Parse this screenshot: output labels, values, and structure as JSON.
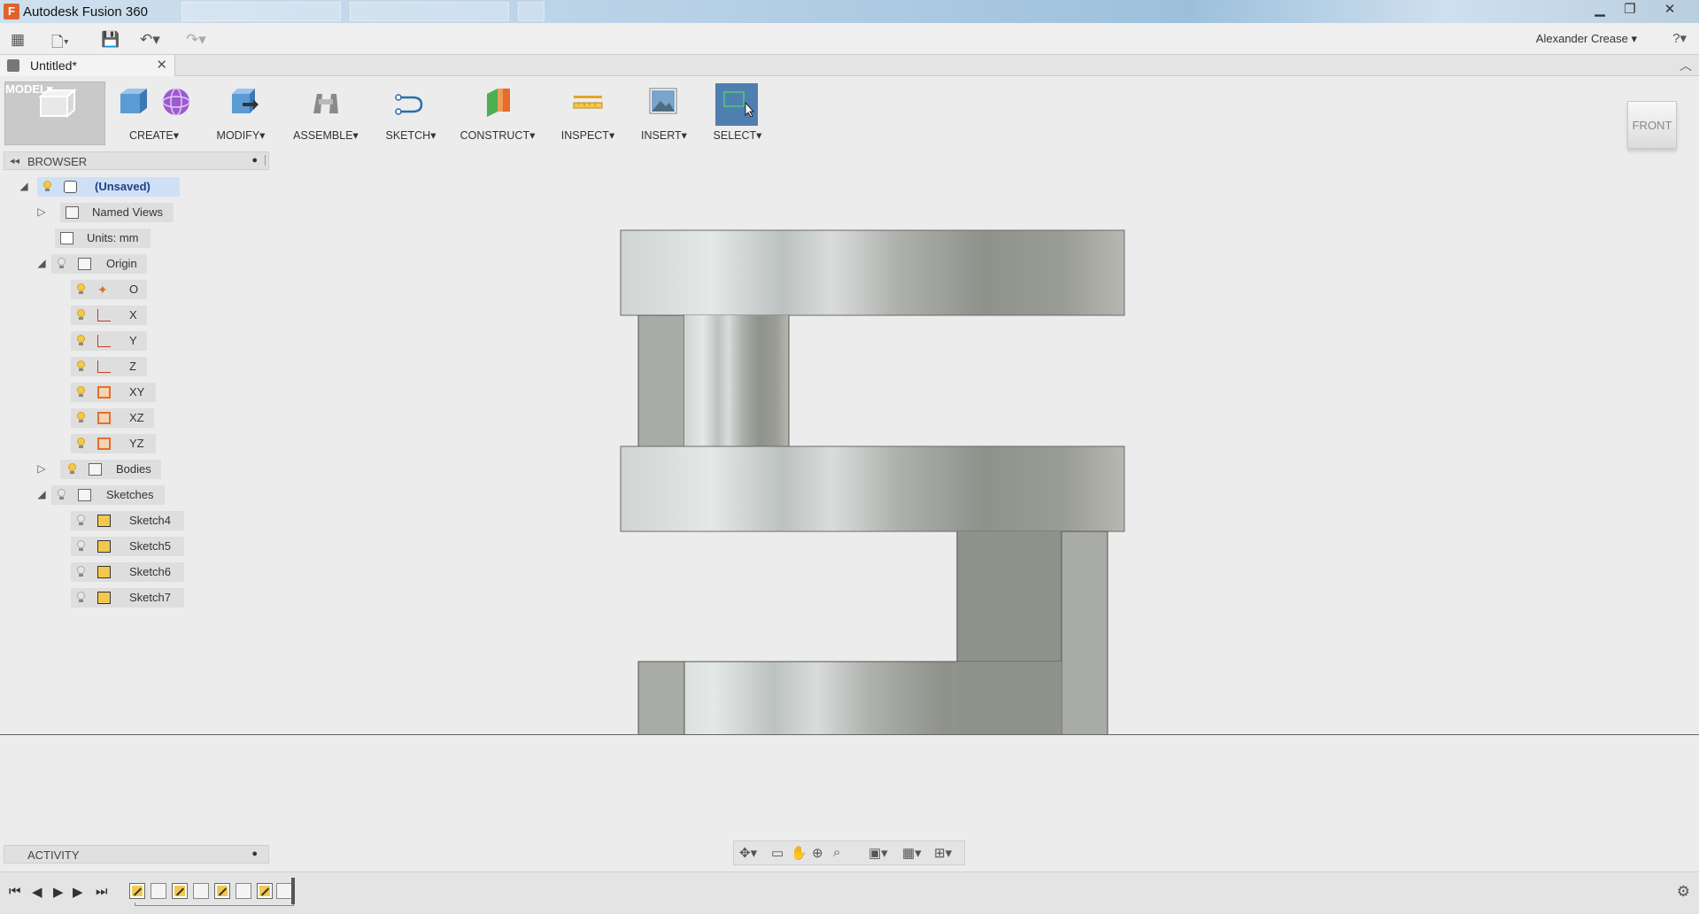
{
  "window": {
    "title": "Autodesk Fusion 360",
    "controls": [
      "minimize",
      "restore",
      "close"
    ]
  },
  "quick_access": {
    "user_name": "Alexander Crease ▾",
    "help": "?▾"
  },
  "document": {
    "tab_title": "Untitled*"
  },
  "toolbar": {
    "workspace_label": "MODEL▾",
    "groups": [
      {
        "label": "CREATE▾",
        "icon": "box-icon"
      },
      {
        "label": "MODIFY▾",
        "icon": "press-pull-icon"
      },
      {
        "label": "ASSEMBLE▾",
        "icon": "joint-icon"
      },
      {
        "label": "SKETCH▾",
        "icon": "sketch-curve-icon"
      },
      {
        "label": "CONSTRUCT▾",
        "icon": "plane-icon"
      },
      {
        "label": "INSPECT▾",
        "icon": "measure-icon"
      },
      {
        "label": "INSERT▾",
        "icon": "image-icon"
      },
      {
        "label": "SELECT▾",
        "icon": "select-box-icon"
      }
    ]
  },
  "viewcube": {
    "face": "FRONT"
  },
  "browser": {
    "title": "BROWSER",
    "root": "(Unsaved)",
    "items": {
      "named_views": "Named Views",
      "units": "Units: mm",
      "origin": "Origin",
      "origin_o": "O",
      "origin_x": "X",
      "origin_y": "Y",
      "origin_z": "Z",
      "origin_xy": "XY",
      "origin_xz": "XZ",
      "origin_yz": "YZ",
      "bodies": "Bodies",
      "sketches": "Sketches",
      "sketch4": "Sketch4",
      "sketch5": "Sketch5",
      "sketch6": "Sketch6",
      "sketch7": "Sketch7"
    }
  },
  "activity": {
    "title": "ACTIVITY"
  },
  "timeline": {
    "features": [
      "sketch",
      "extrude",
      "sketch",
      "extrude",
      "extrude",
      "sketch",
      "extrude",
      "sketch",
      "extrude"
    ]
  },
  "colors": {
    "accent_select": "#4f7fb0",
    "root_highlight": "#cfe0f6",
    "bulb": "#f2c94c"
  }
}
